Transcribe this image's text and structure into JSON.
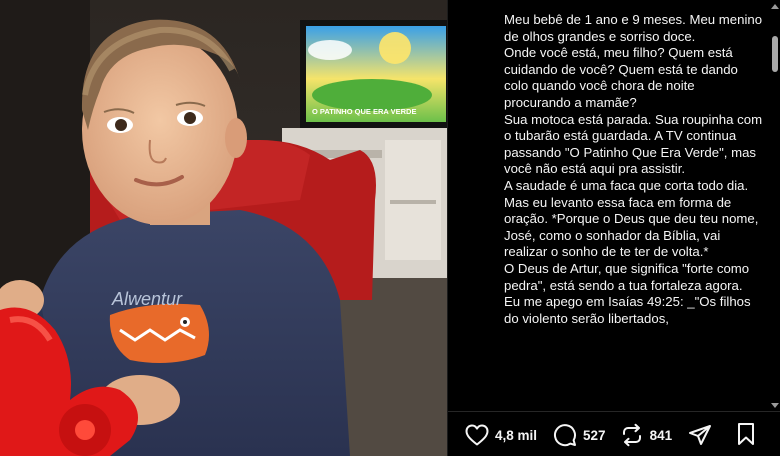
{
  "post": {
    "caption": [
      "Meu bebê de 1 ano e 9 meses. Meu menino de olhos grandes e sorriso doce.",
      "Onde você está, meu filho? Quem está cuidando de você? Quem está te dando colo quando você chora de noite procurando a mamãe?",
      "Sua motoca está parada. Sua roupinha com o tubarão está guardada. A TV continua passando \"O Patinho Que Era Verde\", mas você não está aqui pra assistir.",
      "A saudade é uma faca que corta todo dia. Mas eu levanto essa faca em forma de oração. *Porque o Deus que deu teu nome, José, como o sonhador da Bíblia, vai realizar o sonho de te ter de volta.*",
      "O Deus de Artur, que significa \"forte como pedra\", está sendo a tua fortaleza agora.",
      "Eu me apego em Isaías 49:25: _\"Os filhos do violento serão libertados,"
    ]
  },
  "photo": {
    "tv_caption": "O PATINHO QUE ERA VERDE",
    "shirt_text": "Alwentur"
  },
  "actions": {
    "likes": "4,8 mil",
    "comments": "527",
    "reposts": "841"
  },
  "colors": {
    "background": "#000000",
    "text": "#f5f5f5"
  }
}
